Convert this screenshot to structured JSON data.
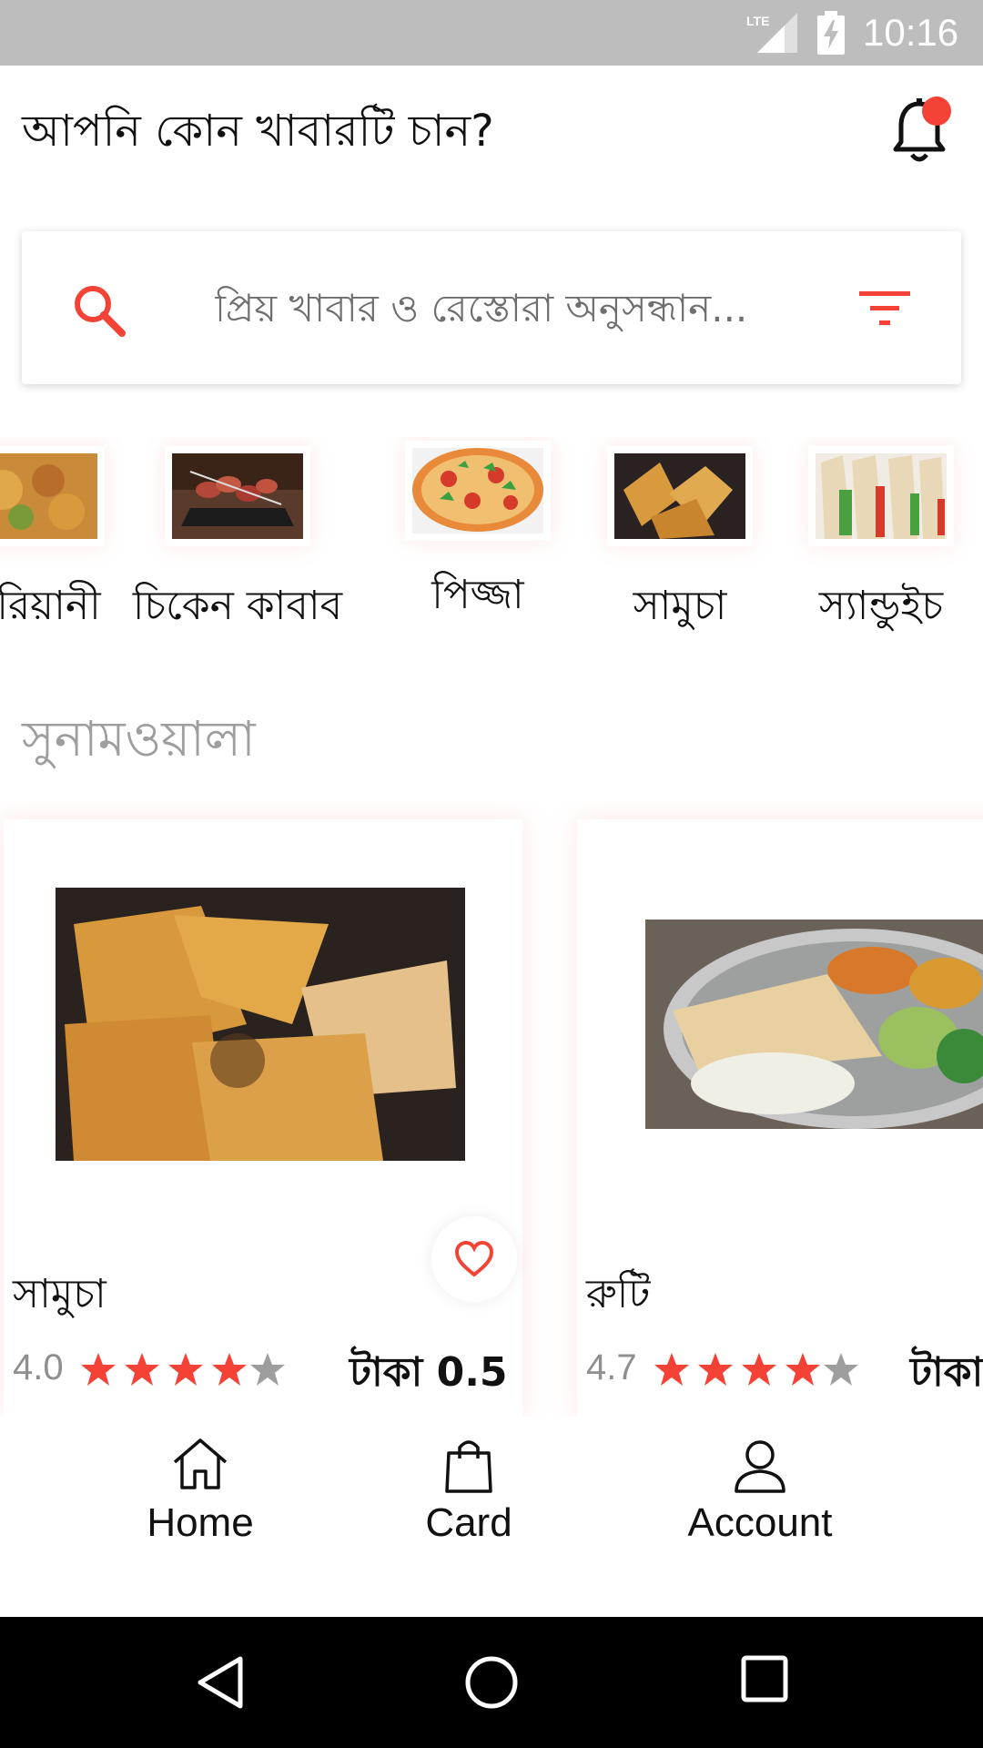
{
  "status_bar": {
    "network": "LTE",
    "time": "10:16"
  },
  "header": {
    "title": "আপনি কোন খাবারটি চান?",
    "notification_icon": "bell-icon",
    "notification_badge_color": "#f44336"
  },
  "search": {
    "placeholder": "প্রিয় খাবার ও রেস্তোরা অনুসন্ধান...",
    "search_icon": "search-icon",
    "filter_icon": "filter-icon"
  },
  "categories": [
    {
      "label": "বিরিয়ানী"
    },
    {
      "label": "চিকেন কাবাব"
    },
    {
      "label": "পিজ্জা"
    },
    {
      "label": "সামুচা"
    },
    {
      "label": "স্যান্ডুইচ"
    }
  ],
  "section": {
    "title": "সুনামওয়ালা"
  },
  "products": [
    {
      "name": "সামুচা",
      "rating": "4.0",
      "stars": 4,
      "price": "টাকা 0.5"
    },
    {
      "name": "রুটি",
      "rating": "4.7",
      "stars": 4,
      "price": "টাকা"
    }
  ],
  "bottom_nav": [
    {
      "label": "Home",
      "icon": "home-icon"
    },
    {
      "label": "Card",
      "icon": "bag-icon"
    },
    {
      "label": "Account",
      "icon": "user-icon"
    }
  ],
  "colors": {
    "accent": "#f44336",
    "star_empty": "#9e9e9e",
    "status_bar": "#bdbdbd"
  }
}
